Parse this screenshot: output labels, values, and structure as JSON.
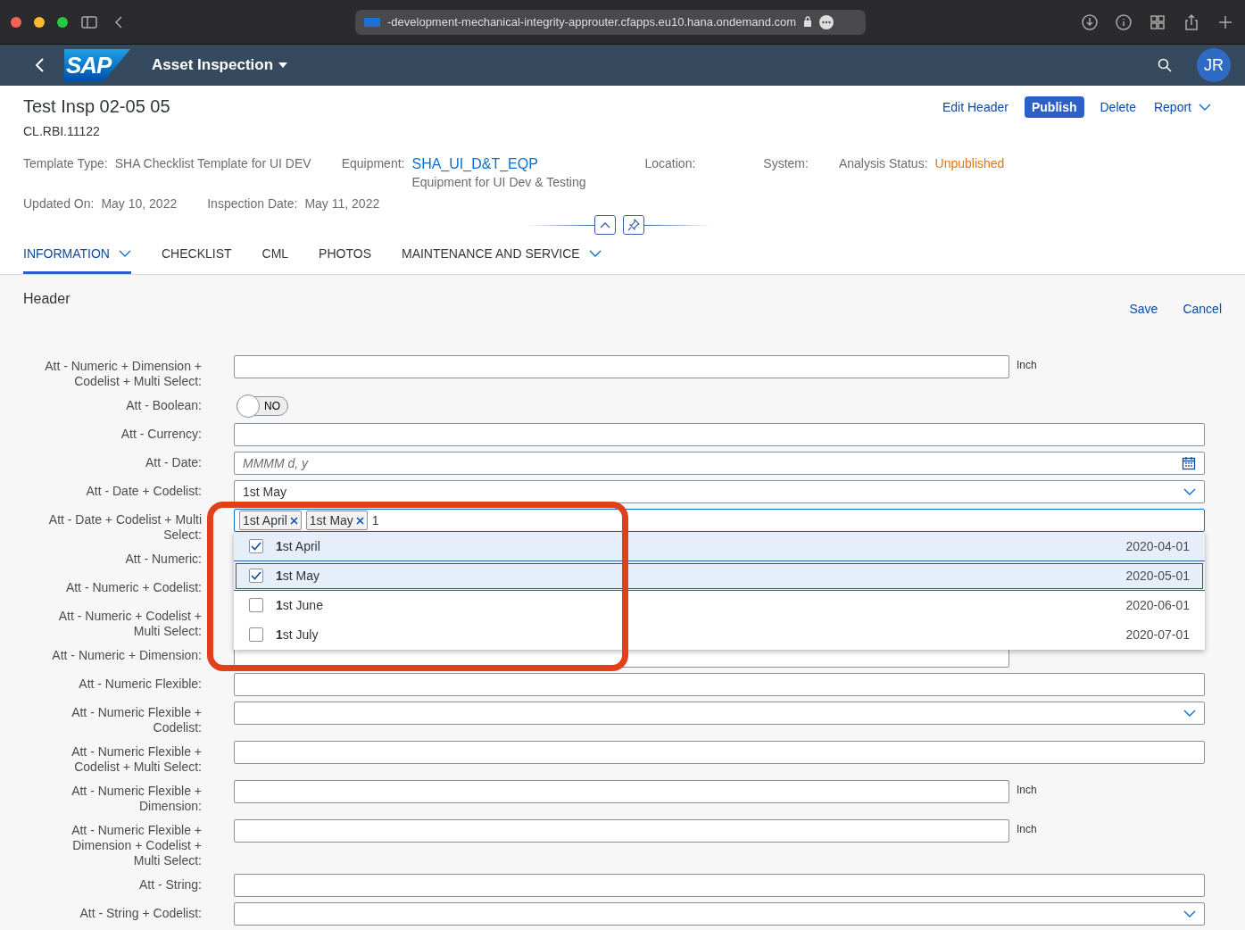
{
  "browser": {
    "url": "-development-mechanical-integrity-approuter.cfapps.eu10.hana.ondemand.com"
  },
  "shell": {
    "logo": "SAP",
    "title": "Asset Inspection",
    "avatar": "JR"
  },
  "object": {
    "title": "Test Insp 02-05 05",
    "subtitle": "CL.RBI.11122",
    "actions": [
      {
        "label": "Edit Header",
        "kind": "link"
      },
      {
        "label": "Publish",
        "kind": "emphasized"
      },
      {
        "label": "Delete",
        "kind": "link"
      },
      {
        "label": "Report",
        "kind": "menu"
      }
    ],
    "attribute_rows": [
      [
        {
          "label": "Template Type:",
          "value": "SHA Checklist Template for UI DEV",
          "kind": "text"
        },
        {
          "label": "Equipment:",
          "value": "SHA_UI_D&T_EQP",
          "description": "Equipment for UI Dev & Testing",
          "kind": "link"
        },
        {
          "label": "Location:"
        },
        {
          "label": "System:"
        },
        {
          "label": "Analysis Status:",
          "value": "Unpublished",
          "kind": "status"
        }
      ],
      [
        {
          "label": "Updated On:",
          "value": "May 10, 2022",
          "kind": "text"
        },
        {
          "label": "Inspection Date:",
          "value": "May 11, 2022",
          "kind": "text"
        }
      ]
    ]
  },
  "tabs": [
    {
      "label": "INFORMATION",
      "selected": true,
      "has_menu": true
    },
    {
      "label": "CHECKLIST",
      "selected": false,
      "has_menu": false
    },
    {
      "label": "CML",
      "selected": false,
      "has_menu": false
    },
    {
      "label": "PHOTOS",
      "selected": false,
      "has_menu": false
    },
    {
      "label": "MAINTENANCE AND SERVICE",
      "selected": false,
      "has_menu": true
    }
  ],
  "section": {
    "title": "Header",
    "actions": [
      "Save",
      "Cancel"
    ]
  },
  "form": [
    {
      "label": "Att - Numeric + Dimension + Codelist + Multi Select:",
      "kind": "dimension",
      "unit": "Inch"
    },
    {
      "label": "Att - Boolean:",
      "kind": "switch",
      "on": false,
      "text": "NO"
    },
    {
      "label": "Att - Currency:",
      "kind": "input"
    },
    {
      "label": "Att - Date:",
      "kind": "date",
      "placeholder": "MMMM d, y"
    },
    {
      "label": "Att - Date + Codelist:",
      "kind": "select",
      "value": "1st May"
    },
    {
      "label": "Att - Date + Codelist + Multi Select:",
      "kind": "multiselect",
      "tokens": [
        "1st April",
        "1st May"
      ],
      "value": "1",
      "highlighted": true,
      "options": [
        {
          "label": "**1**st April",
          "date": "2020-04-01",
          "checked": true,
          "focused": false
        },
        {
          "label": "**1**st May",
          "date": "2020-05-01",
          "checked": true,
          "focused": true
        },
        {
          "label": "**1**st June",
          "date": "2020-06-01",
          "checked": false,
          "focused": false
        },
        {
          "label": "**1**st July",
          "date": "2020-07-01",
          "checked": false,
          "focused": false
        }
      ]
    },
    {
      "label": "Att - Numeric:",
      "kind": "covered"
    },
    {
      "label": "Att - Numeric + Codelist:",
      "kind": "covered"
    },
    {
      "label": "Att - Numeric + Codelist + Multi Select:",
      "kind": "covered"
    },
    {
      "label": "Att - Numeric + Dimension:",
      "kind": "dimension"
    },
    {
      "label": "Att - Numeric Flexible:",
      "kind": "input"
    },
    {
      "label": "Att - Numeric Flexible + Codelist:",
      "kind": "select"
    },
    {
      "label": "Att - Numeric Flexible + Codelist + Multi Select:",
      "kind": "input"
    },
    {
      "label": "Att - Numeric Flexible + Dimension:",
      "kind": "dimension",
      "unit": "Inch"
    },
    {
      "label": "Att - Numeric Flexible + Dimension + Codelist + Multi Select:",
      "kind": "dimension",
      "unit": "Inch"
    },
    {
      "label": "Att - String:",
      "kind": "input"
    },
    {
      "label": "Att - String + Codelist:",
      "kind": "select"
    }
  ]
}
